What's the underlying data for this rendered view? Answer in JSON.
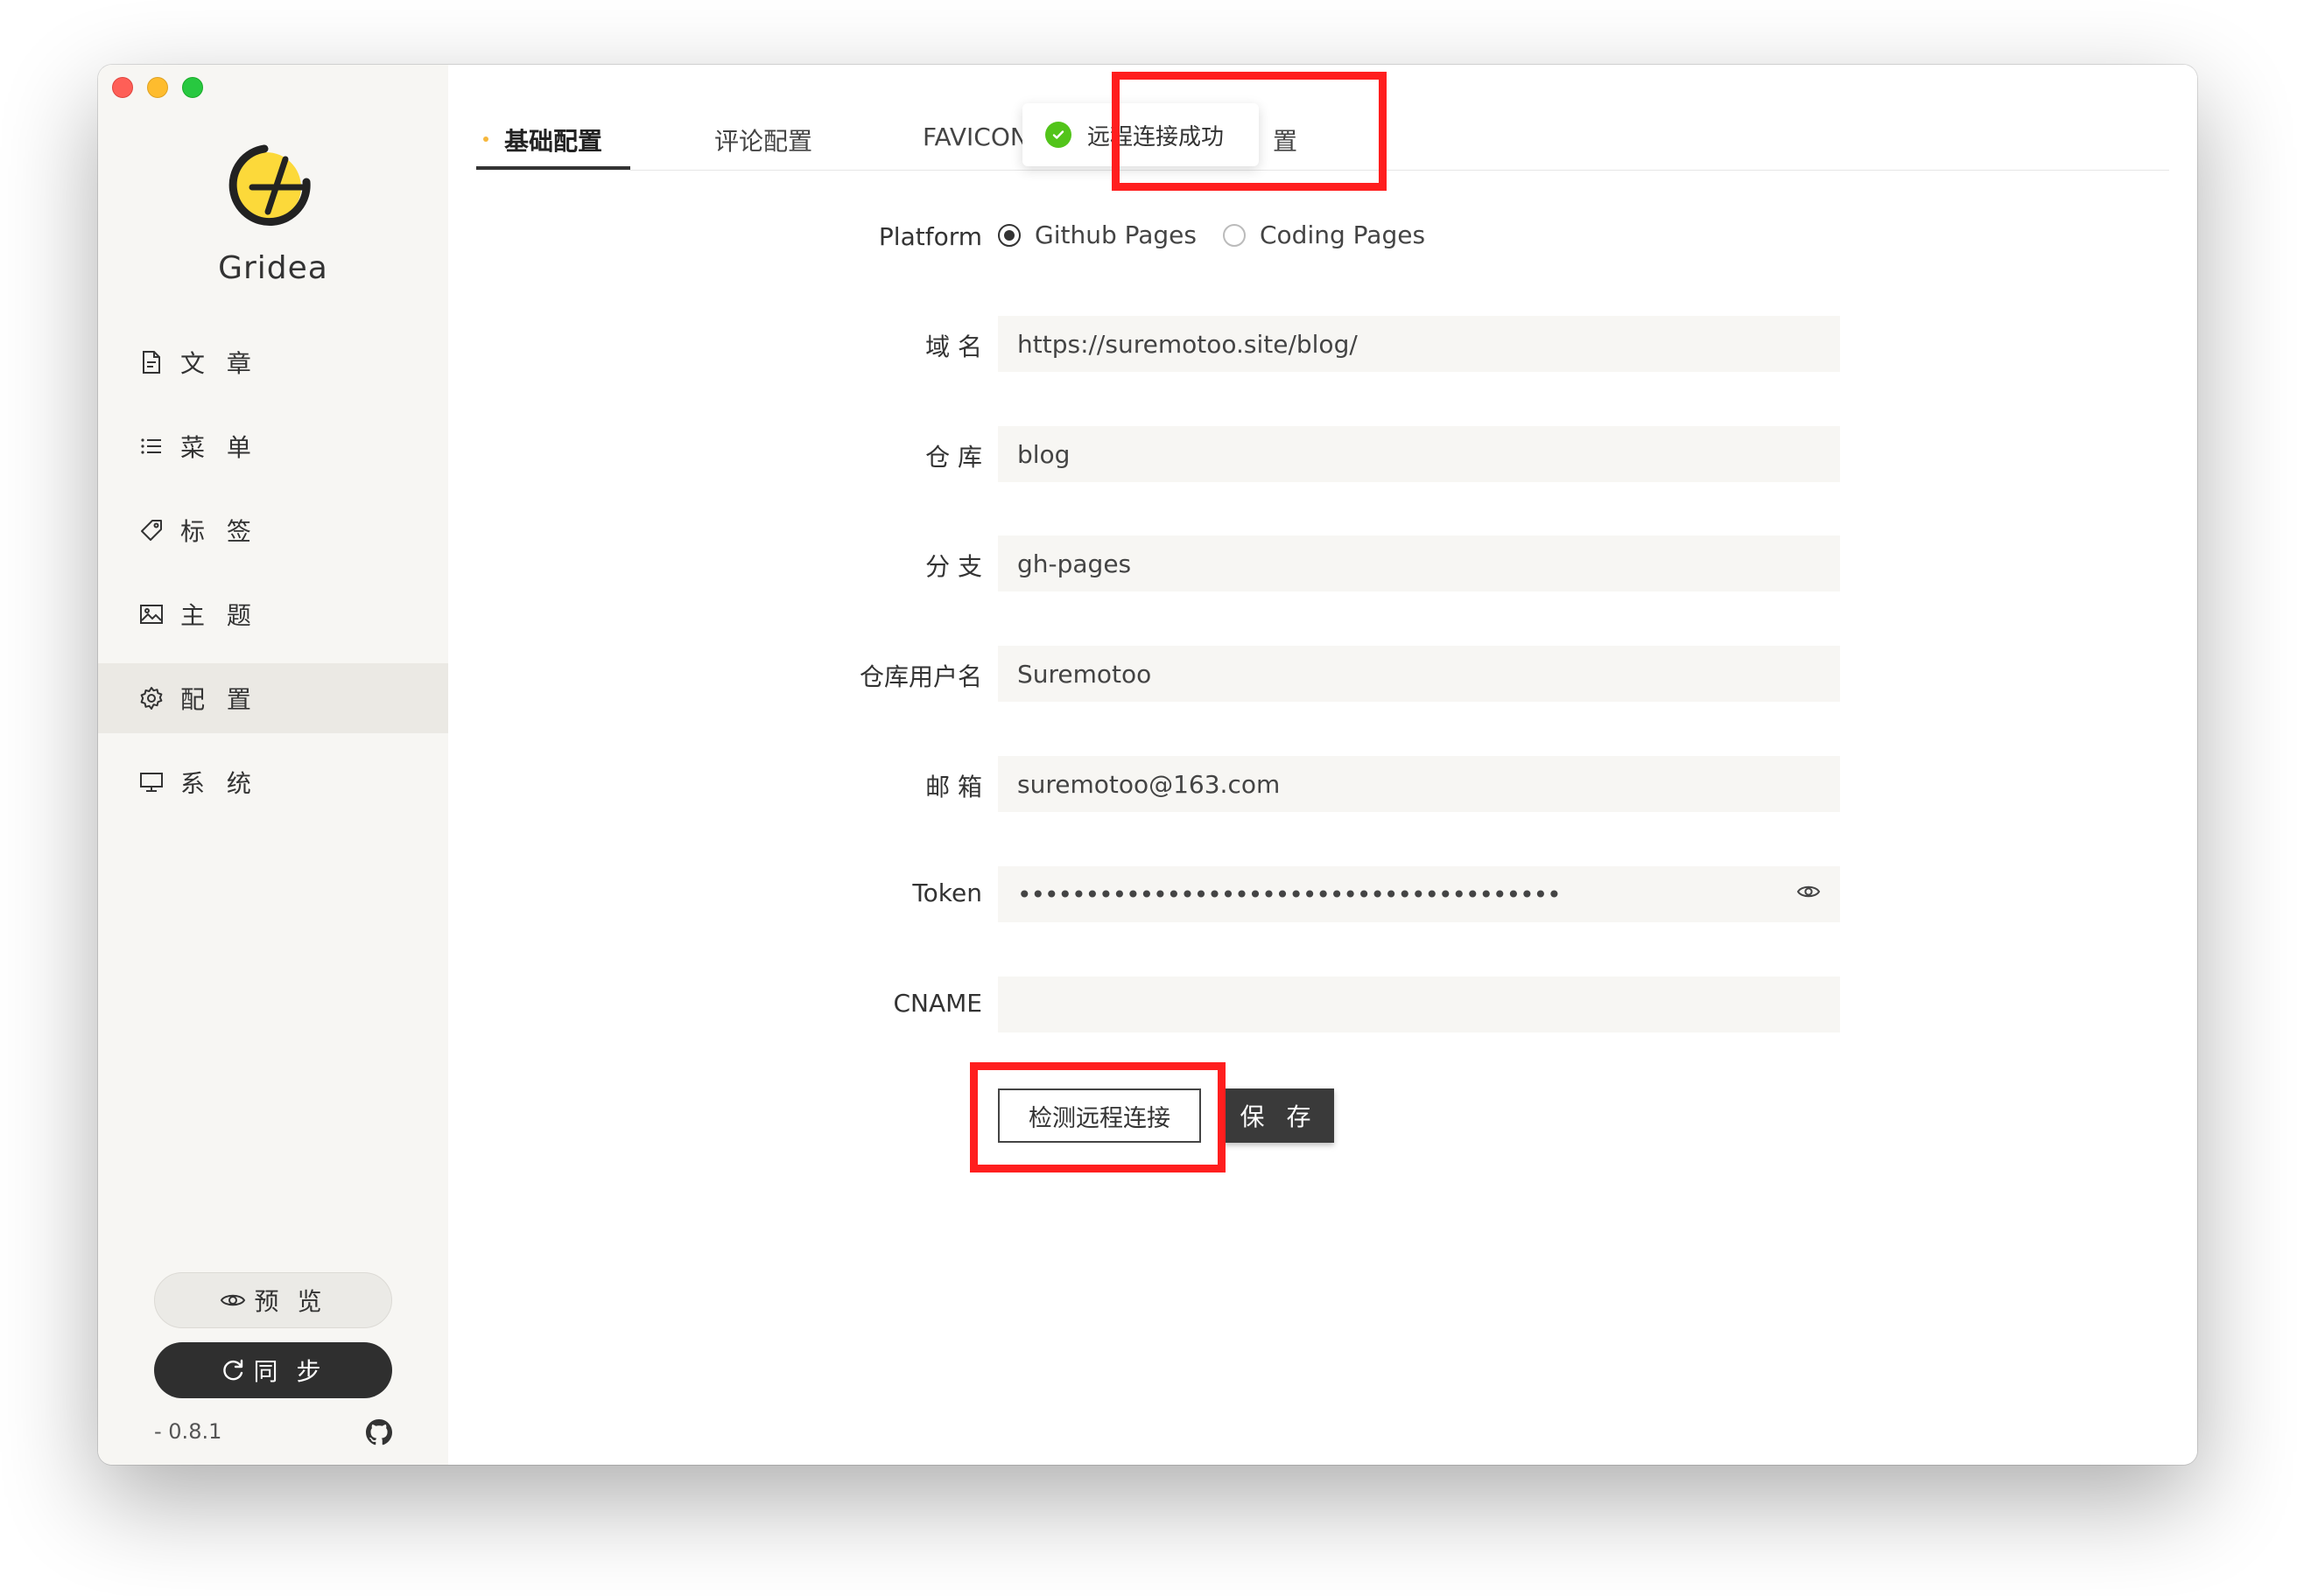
{
  "app": {
    "name": "Gridea",
    "version": "- 0.8.1"
  },
  "sidebar": {
    "items": [
      {
        "label": "文 章",
        "icon": "article-icon"
      },
      {
        "label": "菜 单",
        "icon": "menu-list-icon"
      },
      {
        "label": "标 签",
        "icon": "tag-icon"
      },
      {
        "label": "主 题",
        "icon": "image-icon"
      },
      {
        "label": "配 置",
        "icon": "gear-icon",
        "active": true
      },
      {
        "label": "系 统",
        "icon": "monitor-icon"
      }
    ],
    "preview_label": "预 览",
    "sync_label": "同 步"
  },
  "tabs": [
    {
      "label": "基础配置",
      "active": true
    },
    {
      "label": "评论配置"
    },
    {
      "label": "FAVICON"
    },
    {
      "label": "置"
    }
  ],
  "toast": {
    "message": "远程连接成功",
    "status": "success"
  },
  "form": {
    "platform_label": "Platform",
    "platform_options": [
      "Github Pages",
      "Coding Pages"
    ],
    "platform_selected": "Github Pages",
    "domain_label": "域 名",
    "domain_value": "https://suremotoo.site/blog/",
    "repo_label": "仓 库",
    "repo_value": "blog",
    "branch_label": "分 支",
    "branch_value": "gh-pages",
    "username_label": "仓库用户名",
    "username_value": "Suremotoo",
    "email_label": "邮 箱",
    "email_value": "suremotoo@163.com",
    "token_label": "Token",
    "token_value": "••••••••••••••••••••••••••••••••••••••••",
    "cname_label": "CNAME",
    "cname_value": "",
    "check_button": "检测远程连接",
    "save_button": "保 存"
  },
  "colors": {
    "highlight": "#ff1e1e",
    "success": "#52c41a",
    "accent": "#f6b73c",
    "sidebar_bg": "#f7f6f3"
  }
}
